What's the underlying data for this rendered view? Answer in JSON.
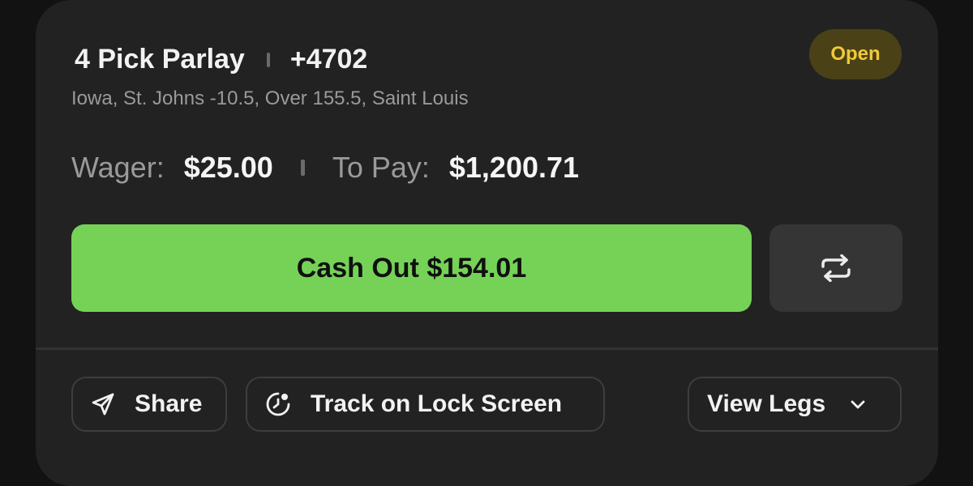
{
  "bet": {
    "title": "4 Pick Parlay",
    "odds": "+4702",
    "selections": "Iowa, St. Johns -10.5, Over 155.5, Saint Louis",
    "status": "Open"
  },
  "amounts": {
    "wager_label": "Wager:",
    "wager_value": "$25.00",
    "topay_label": "To Pay:",
    "topay_value": "$1,200.71"
  },
  "actions": {
    "cashout_label": "Cash Out $154.01",
    "share_label": "Share",
    "track_label": "Track on Lock Screen",
    "view_legs_label": "View Legs"
  },
  "icons": {
    "refresh": "refresh-arrows-icon",
    "share": "paper-plane-icon",
    "track": "lock-screen-icon",
    "legs": "chevron-down-icon"
  },
  "colors": {
    "accent_green": "#75d257",
    "badge_text": "#f0c93a",
    "badge_bg": "#4a4216",
    "card_bg": "#222222"
  }
}
